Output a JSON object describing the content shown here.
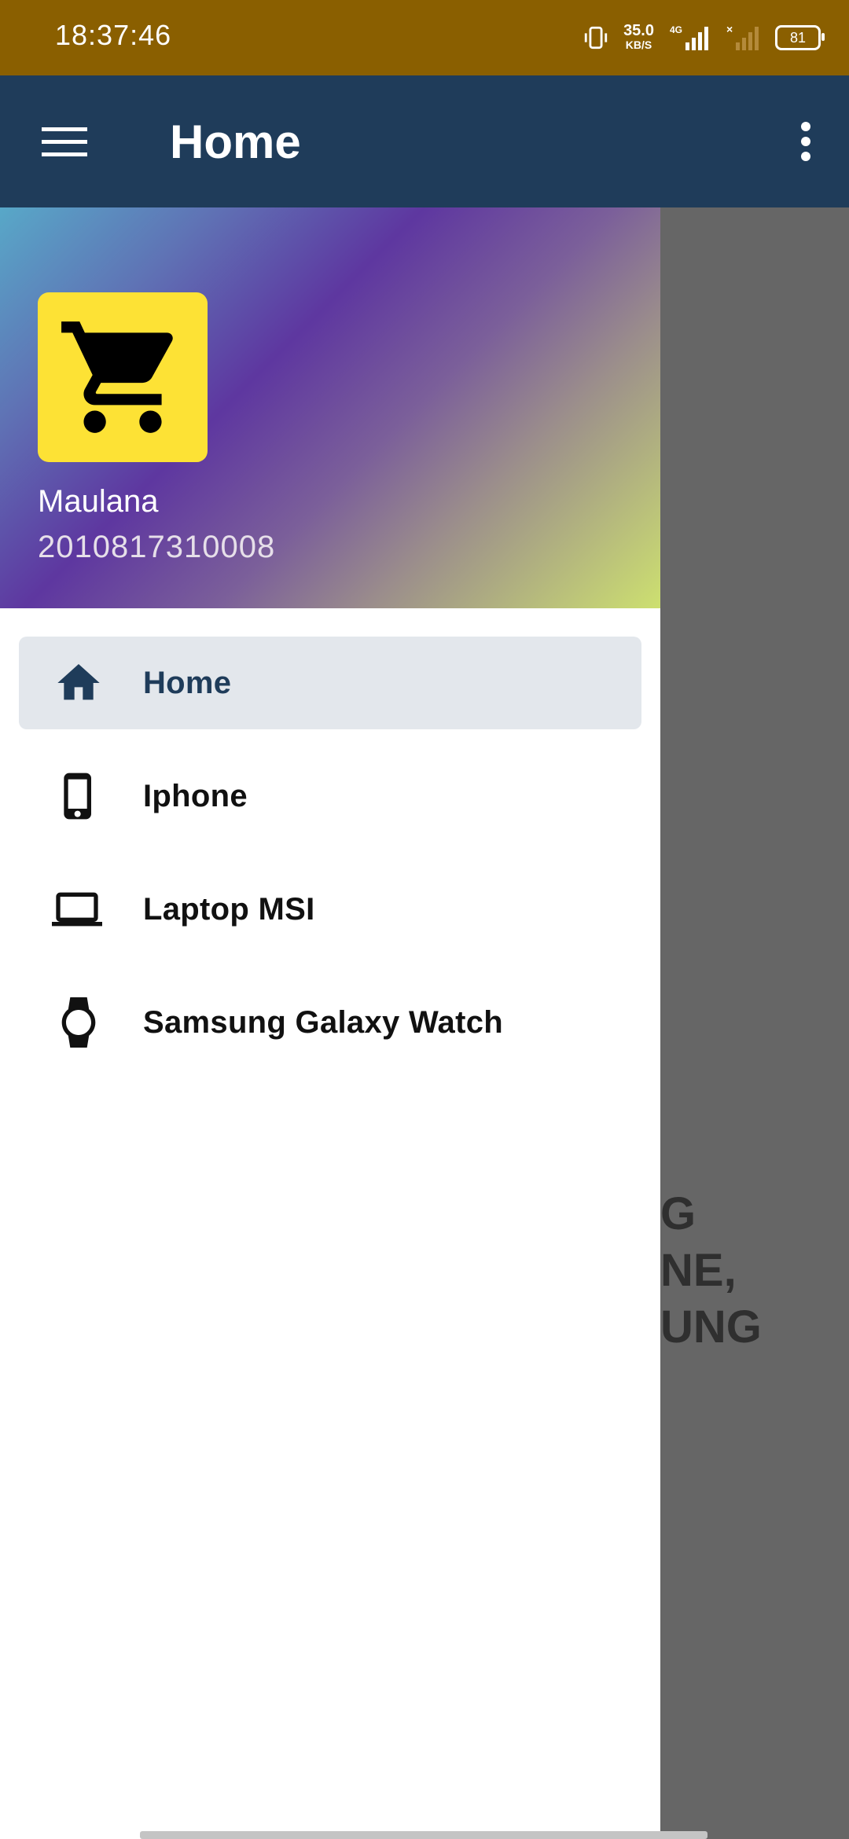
{
  "status_bar": {
    "time": "18:37:46",
    "speed_value": "35.0",
    "speed_unit": "KB/S",
    "network": "4G",
    "battery": "81"
  },
  "app_bar": {
    "title": "Home",
    "menu_icon": "hamburger-menu-icon",
    "overflow_icon": "more-vert-icon",
    "color": "#1f3c5a"
  },
  "drawer": {
    "header": {
      "avatar_icon": "shopping-cart-icon",
      "user_name": "Maulana",
      "user_id": "2010817310008"
    },
    "items": [
      {
        "label": "Home",
        "icon": "home-icon",
        "active": true
      },
      {
        "label": "Iphone",
        "icon": "phone-icon",
        "active": false
      },
      {
        "label": "Laptop MSI",
        "icon": "laptop-icon",
        "active": false
      },
      {
        "label": "Samsung Galaxy Watch",
        "icon": "watch-icon",
        "active": false
      }
    ]
  },
  "background_content": {
    "line1": "G",
    "line2": "NE,",
    "line3": "UNG"
  }
}
